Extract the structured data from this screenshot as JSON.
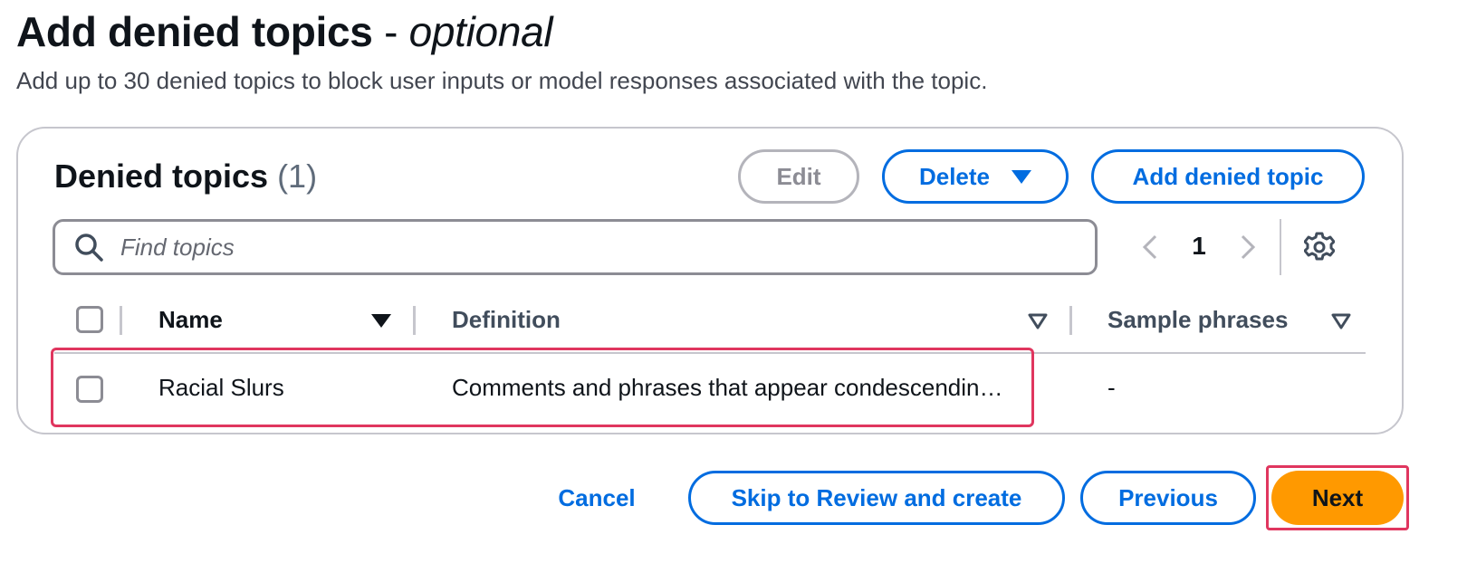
{
  "header": {
    "title": "Add denied topics",
    "title_separator": "-",
    "title_optional": "optional",
    "description": "Add up to 30 denied topics to block user inputs or model responses associated with the topic."
  },
  "panel": {
    "title": "Denied topics",
    "count": "(1)",
    "actions": {
      "edit_label": "Edit",
      "delete_label": "Delete",
      "add_label": "Add denied topic"
    },
    "search": {
      "placeholder": "Find topics",
      "value": ""
    },
    "pagination": {
      "current_page": "1"
    },
    "table": {
      "columns": [
        "Name",
        "Definition",
        "Sample phrases"
      ],
      "rows": [
        {
          "name": "Racial Slurs",
          "definition": "Comments and phrases that appear condescendin…",
          "sample_phrases": "-"
        }
      ]
    }
  },
  "footer": {
    "cancel_label": "Cancel",
    "skip_label": "Skip to Review and create",
    "previous_label": "Previous",
    "next_label": "Next"
  },
  "colors": {
    "link": "#006ce0",
    "primary": "#ff9900",
    "highlight": "#e0365f",
    "border": "#c6c6cd"
  },
  "icons": [
    "search-icon",
    "chevron-left-icon",
    "chevron-right-icon",
    "gear-icon",
    "caret-down-icon",
    "sort-descending-icon",
    "sort-icon"
  ]
}
